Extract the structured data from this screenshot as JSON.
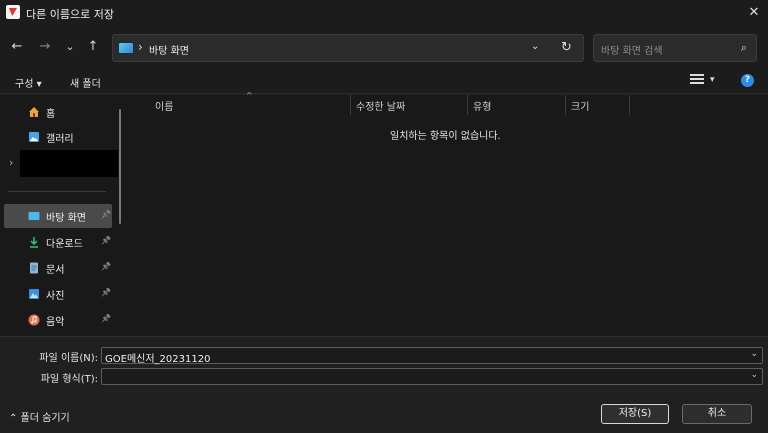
{
  "window": {
    "title": "다른 이름으로 저장",
    "close_glyph": "✕"
  },
  "nav": {
    "back_glyph": "←",
    "forward_glyph": "→",
    "recent_glyph": "⌄",
    "up_glyph": "↑",
    "breadcrumb_separator": "›",
    "breadcrumb": "바탕 화면",
    "dropdown_glyph": "⌄",
    "refresh_glyph": "↻",
    "search_placeholder": "바탕 화면 검색",
    "search_glyph": "⌕"
  },
  "toolbar": {
    "organize": "구성 ▾",
    "new_folder": "새 폴더",
    "view_dropdown": "▾",
    "help": "?"
  },
  "sidebar": {
    "items": [
      {
        "label": "홈",
        "icon": "home-icon"
      },
      {
        "label": "갤러리",
        "icon": "gallery-icon"
      },
      {
        "label": "바탕 화면",
        "icon": "desktop-icon",
        "selected": true,
        "pinned": true
      },
      {
        "label": "다운로드",
        "icon": "download-icon",
        "pinned": true
      },
      {
        "label": "문서",
        "icon": "document-icon",
        "pinned": true
      },
      {
        "label": "사진",
        "icon": "pictures-icon",
        "pinned": true
      },
      {
        "label": "음악",
        "icon": "music-icon",
        "pinned": true
      }
    ],
    "expand_glyph": "›",
    "pin_glyph": "📌"
  },
  "list": {
    "columns": [
      "이름",
      "수정한 날짜",
      "유형",
      "크기"
    ],
    "sort_glyph": "^",
    "empty_message": "일치하는 항목이 없습니다."
  },
  "form": {
    "filename_label": "파일 이름(N):",
    "filename_value": "GOE메신저_20231120",
    "filetype_label": "파일 형식(T):",
    "filetype_value": "",
    "dropdown_glyph": "⌄"
  },
  "footer": {
    "hide_folders": "⌃  폴더 숨기기",
    "save": "저장(S)",
    "cancel": "취소"
  },
  "colors": {
    "background": "#202020",
    "accent": "#2e8ce8",
    "selection": "#4a4a4a"
  }
}
